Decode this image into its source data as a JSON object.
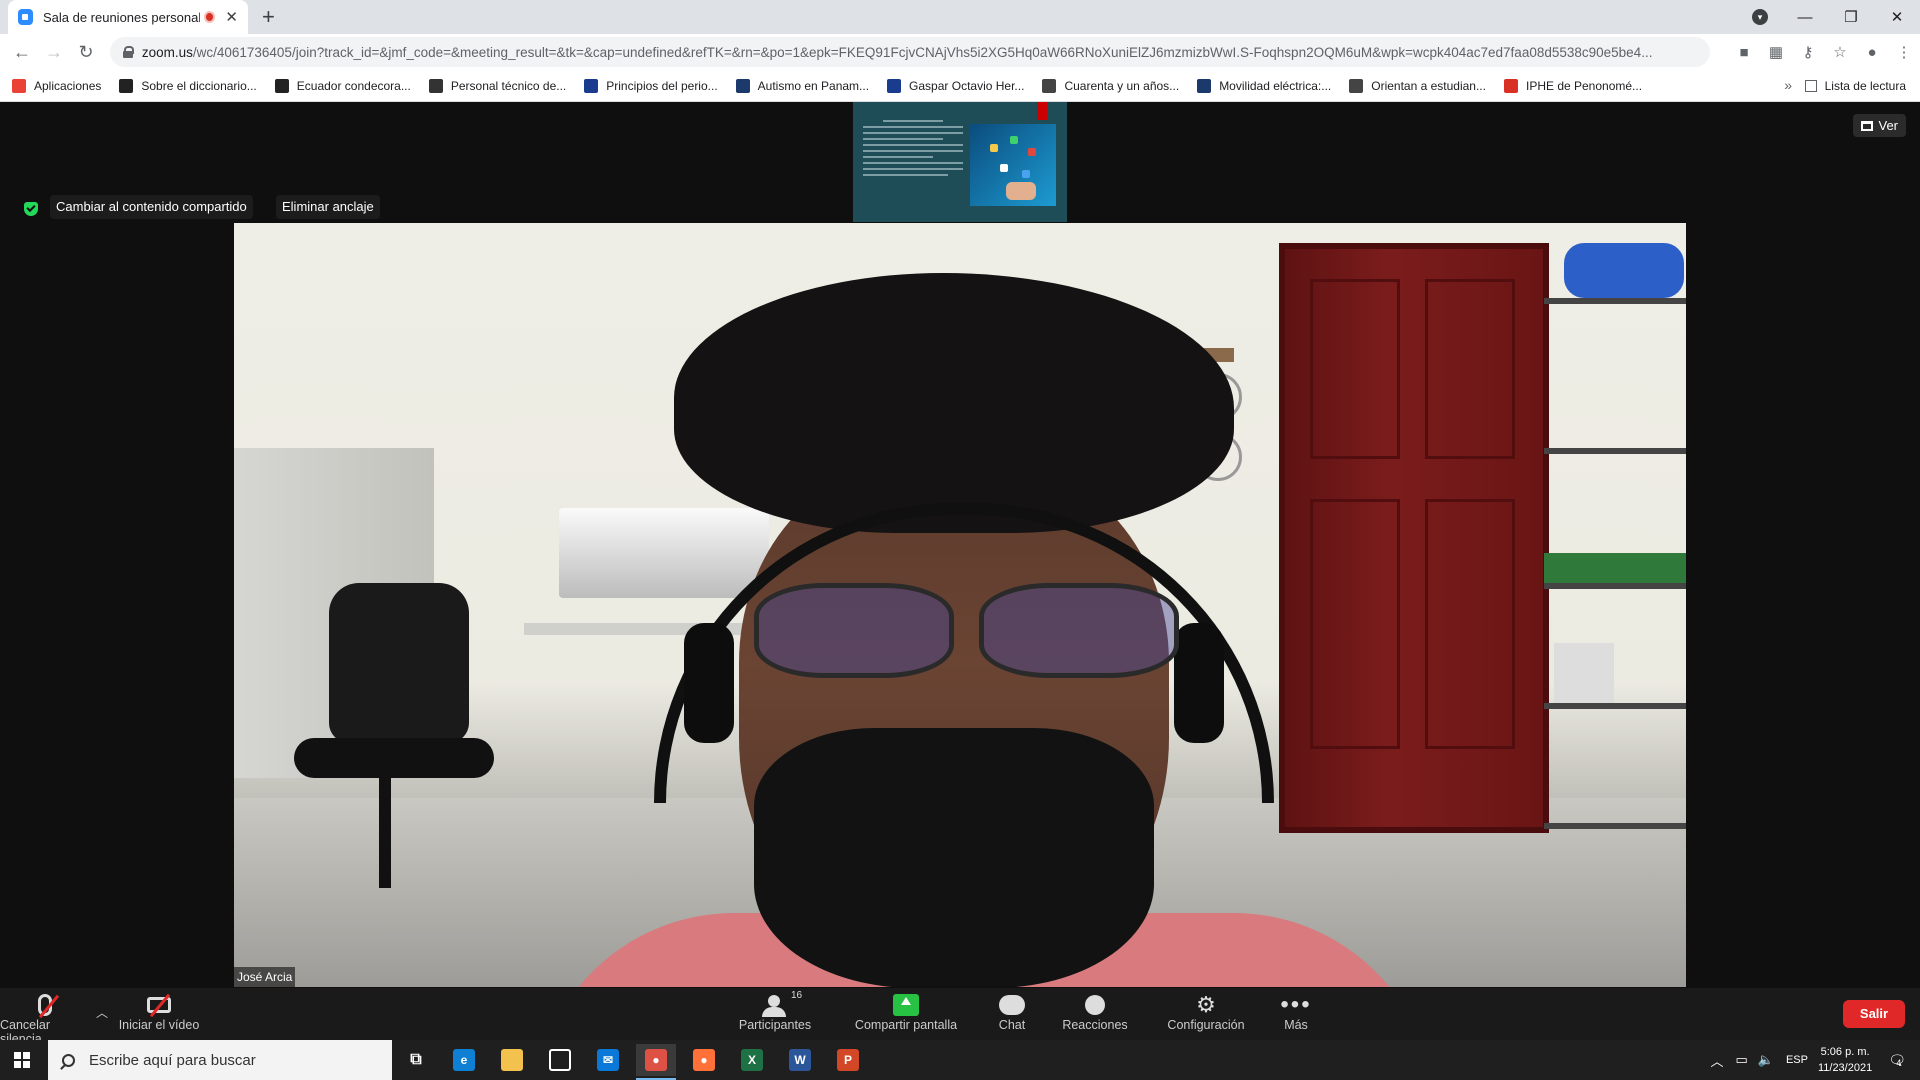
{
  "browser": {
    "tab_title": "Sala de reuniones personales",
    "url_host": "zoom.us",
    "url_path": "/wc/4061736405/join?track_id=&jmf_code=&meeting_result=&tk=&cap=undefined&refTK=&rn=&po=1&epk=FKEQ91FcjvCNAjVhs5i2XG5Hq0aW66RNoXuniElZJ6mzmizbWwI.S-Foqhspn2OQM6uM&wpk=wcpk404ac7ed7faa08d5538c90e5be4...",
    "reading_list_label": "Lista de lectura",
    "bookmarks": [
      {
        "label": "Aplicaciones",
        "icon": "apps-grid-icon",
        "color": "#ea4335"
      },
      {
        "label": "Sobre el diccionario...",
        "icon": "p-icon",
        "color": "#222222"
      },
      {
        "label": "Ecuador condecora...",
        "icon": "p-icon",
        "color": "#222222"
      },
      {
        "label": "Personal técnico de...",
        "icon": "b-icon",
        "color": "#333333"
      },
      {
        "label": "Principios del perio...",
        "icon": "flag-icon",
        "color": "#1a3c8f"
      },
      {
        "label": "Autismo en Panam...",
        "icon": "tvn-icon",
        "color": "#1b3a6b"
      },
      {
        "label": "Gaspar Octavio Her...",
        "icon": "flag-icon",
        "color": "#1a3c8f"
      },
      {
        "label": "Cuarenta y un años...",
        "icon": "e-icon",
        "color": "#444444"
      },
      {
        "label": "Movilidad eléctrica:...",
        "icon": "tvn-icon",
        "color": "#1b3a6b"
      },
      {
        "label": "Orientan a estudian...",
        "icon": "e-icon",
        "color": "#444444"
      },
      {
        "label": "IPHE de Penonomé...",
        "icon": "on-icon",
        "color": "#d93025"
      }
    ]
  },
  "meeting": {
    "switch_shared_label": "Cambiar al contenido compartido",
    "unpin_label": "Eliminar anclaje",
    "view_label": "Ver",
    "participant_name": "José Arcia"
  },
  "footer": {
    "unmute_label": "Cancelar silencia",
    "start_video_label": "Iniciar el vídeo",
    "participants_label": "Participantes",
    "participants_count": "16",
    "share_label": "Compartir pantalla",
    "chat_label": "Chat",
    "reactions_label": "Reacciones",
    "settings_label": "Configuración",
    "more_label": "Más",
    "leave_label": "Salir"
  },
  "taskbar": {
    "search_placeholder": "Escribe aquí para buscar",
    "language": "ESP",
    "time": "5:06 p. m.",
    "date": "11/23/2021",
    "notifications_count": "4",
    "apps": [
      {
        "name": "task-view-icon",
        "color": "#1f1f1f",
        "glyph": "⧉"
      },
      {
        "name": "edge-icon",
        "color": "#0f7fd4",
        "glyph": "e"
      },
      {
        "name": "file-explorer-icon",
        "color": "#f2c14e",
        "glyph": ""
      },
      {
        "name": "store-icon",
        "color": "#ffffff",
        "glyph": ""
      },
      {
        "name": "mail-icon",
        "color": "#0a78d7",
        "glyph": "✉"
      },
      {
        "name": "chrome-icon",
        "color": "#de5246",
        "glyph": "●"
      },
      {
        "name": "firefox-icon",
        "color": "#ff7139",
        "glyph": "●"
      },
      {
        "name": "excel-icon",
        "color": "#1e7145",
        "glyph": "X"
      },
      {
        "name": "word-icon",
        "color": "#2b579a",
        "glyph": "W"
      },
      {
        "name": "powerpoint-icon",
        "color": "#d24726",
        "glyph": "P"
      }
    ]
  }
}
